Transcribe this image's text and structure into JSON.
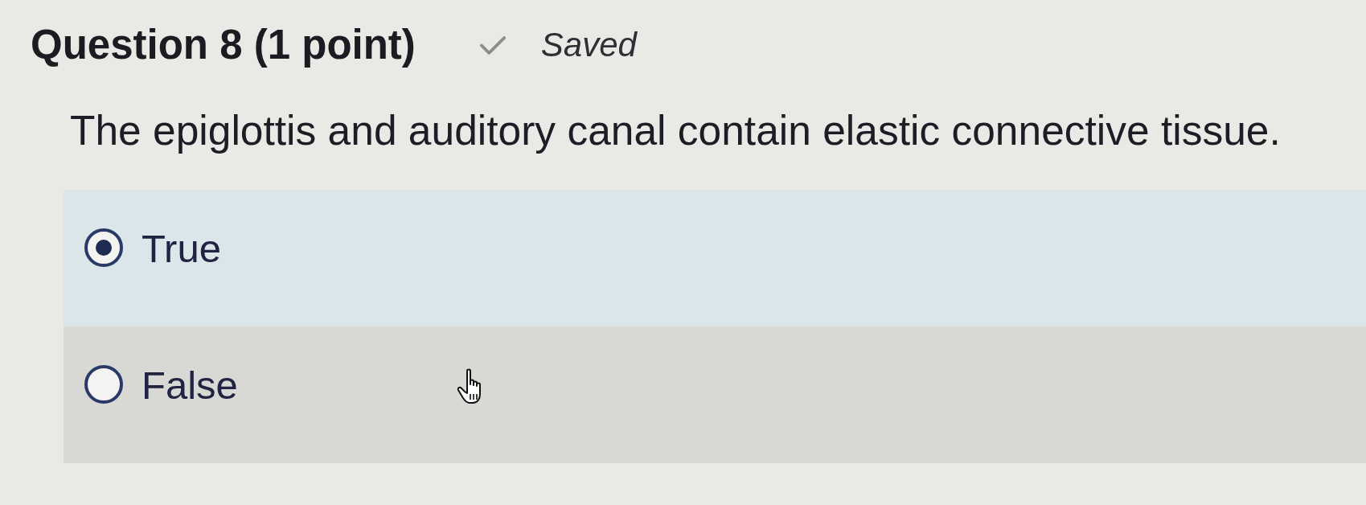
{
  "question": {
    "title": "Question 8 (1 point)",
    "save_status": {
      "saved": true,
      "label": "Saved"
    },
    "prompt": "The epiglottis and auditory canal contain elastic connective tissue."
  },
  "options": [
    {
      "label": "True",
      "selected": true,
      "hovered": false
    },
    {
      "label": "False",
      "selected": false,
      "hovered": true
    }
  ]
}
